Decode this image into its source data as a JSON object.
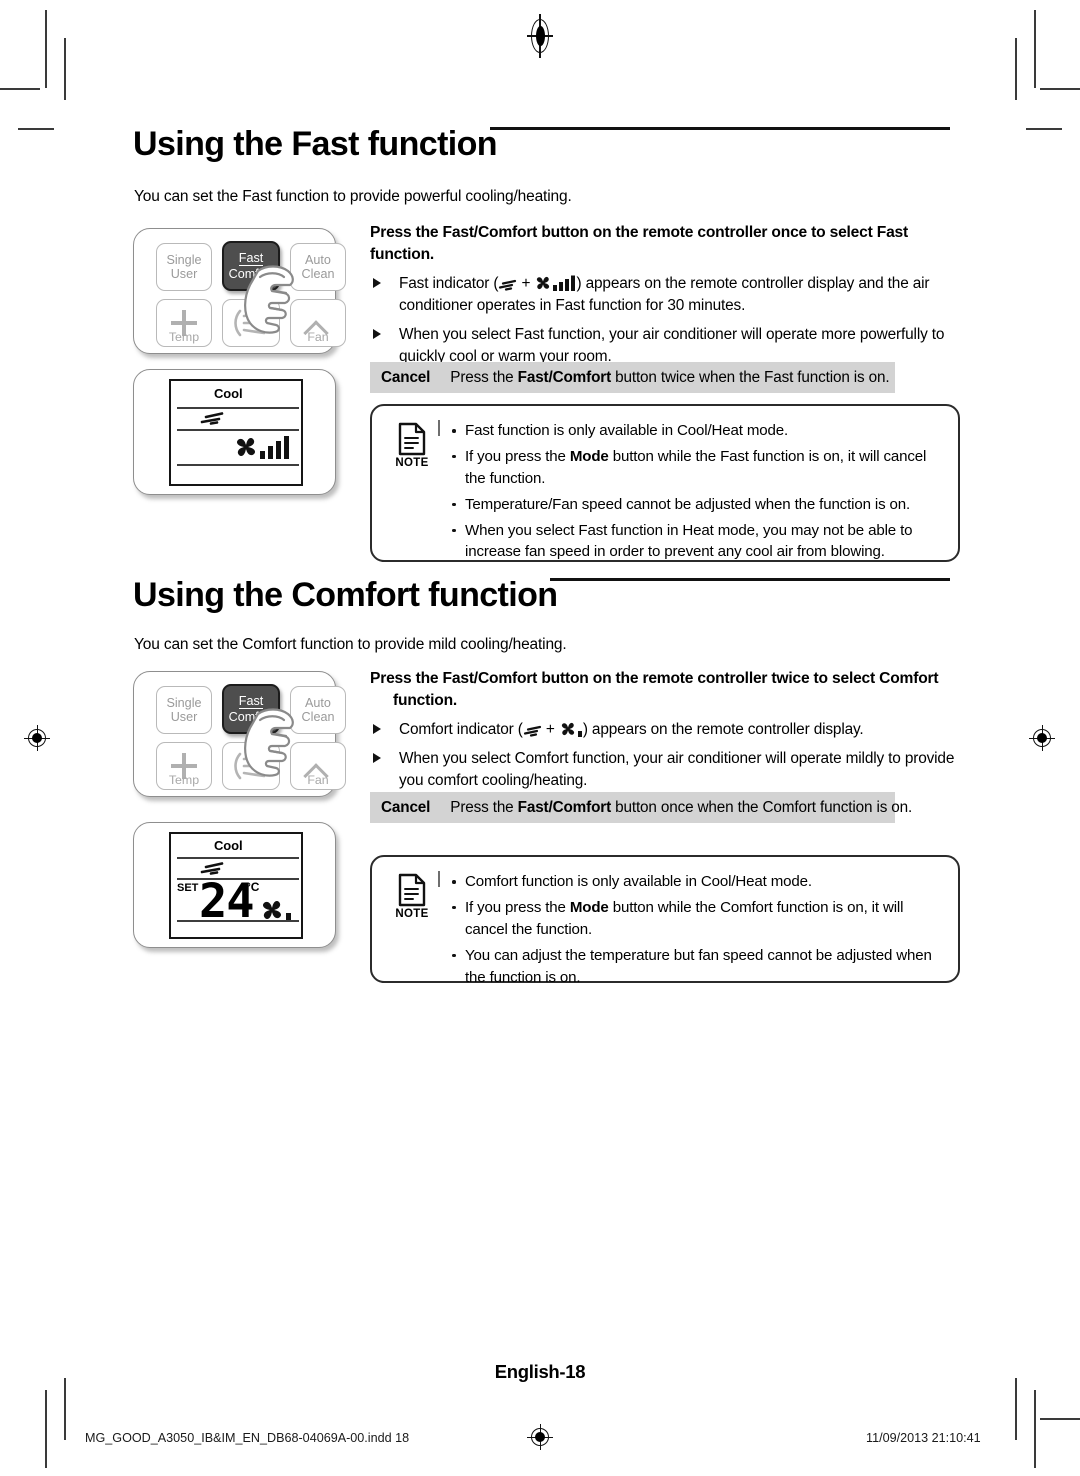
{
  "document": {
    "page_number_label": "English-18",
    "footer_file": "MG_GOOD_A3050_IB&IM_EN_DB68-04069A-00.indd   18",
    "footer_date": "11/09/2013   21:10:41"
  },
  "sections": [
    {
      "id": "fast",
      "title": "Using the Fast function",
      "intro": "You can set the Fast function to provide powerful cooling/heating.",
      "lead": {
        "before": "Press the ",
        "bold": "Fast/Comfort",
        "after": " button on the remote controller once to select Fast function.",
        "second_line": ""
      },
      "bullets": [
        {
          "pre": "Fast indicator (",
          "icons": "swirl + fan-4bars",
          "post": ") appears on the remote controller display and the air conditioner operates in Fast function for 30 minutes."
        },
        {
          "pre": "",
          "icons": "",
          "post": "When you select Fast function, your air conditioner will operate more powerfully to quickly cool or warm your room."
        }
      ],
      "cancel": {
        "label": "Cancel",
        "before": "Press the ",
        "bold": "Fast/Comfort",
        "after": " button twice when the Fast function is on."
      },
      "note": {
        "label": "NOTE",
        "items": [
          {
            "text": "Fast function is only available in Cool/Heat mode.",
            "bold": ""
          },
          {
            "pre": "If you press the ",
            "bold": "Mode",
            "post": " button while the Fast function is on, it will cancel the function."
          },
          {
            "text": "Temperature/Fan speed cannot be adjusted when the function is on.",
            "bold": ""
          },
          {
            "text": "When you select Fast function in Heat mode, you may not be able to increase fan speed in order to prevent any cool air from blowing.",
            "bold": ""
          }
        ]
      },
      "remote": {
        "buttons": [
          {
            "line1": "Single",
            "line2": "User",
            "state": "normal"
          },
          {
            "line1": "Fast",
            "line2": "Comfort",
            "state": "pressed"
          },
          {
            "line1": "Auto",
            "line2": "Clean",
            "state": "normal"
          },
          {
            "line1": "",
            "line2": "Temp",
            "state": "icon-plus"
          },
          {
            "line1": "",
            "line2": "",
            "state": "icon-swing"
          },
          {
            "line1": "",
            "line2": "Fan",
            "state": "icon-chevron"
          }
        ]
      },
      "lcd": {
        "mode": "Cool",
        "set_label": "",
        "temperature": "",
        "unit": "",
        "show_temp": false,
        "fan_bars": 4
      }
    },
    {
      "id": "comfort",
      "title": "Using the Comfort function",
      "intro": "You can set the Comfort function to provide mild cooling/heating.",
      "lead": {
        "before": "Press the ",
        "bold": "Fast/Comfort",
        "after": " button on the remote controller twice to select Comfort",
        "second_line": "function."
      },
      "bullets": [
        {
          "pre": "Comfort indicator (",
          "icons": "swirl + fan-1bar",
          "post": ") appears on the remote controller display."
        },
        {
          "pre": "",
          "icons": "",
          "post": "When you select Comfort function, your air conditioner will operate mildly to provide you comfort cooling/heating."
        }
      ],
      "cancel": {
        "label": "Cancel",
        "before": "Press the ",
        "bold": "Fast/Comfort",
        "after": " button once when the Comfort function is on."
      },
      "note": {
        "label": "NOTE",
        "items": [
          {
            "text": "Comfort function is only available in Cool/Heat mode.",
            "bold": ""
          },
          {
            "pre": "If you press the ",
            "bold": "Mode",
            "post": " button while the Comfort function is on, it will cancel the function."
          },
          {
            "text": "You can adjust the temperature but fan speed cannot be adjusted when the function is on.",
            "bold": ""
          }
        ]
      },
      "remote": {
        "buttons": [
          {
            "line1": "Single",
            "line2": "User",
            "state": "normal"
          },
          {
            "line1": "Fast",
            "line2": "Comfort",
            "state": "pressed"
          },
          {
            "line1": "Auto",
            "line2": "Clean",
            "state": "normal"
          },
          {
            "line1": "",
            "line2": "Temp",
            "state": "icon-plus"
          },
          {
            "line1": "",
            "line2": "",
            "state": "icon-swing"
          },
          {
            "line1": "",
            "line2": "Fan",
            "state": "icon-chevron"
          }
        ]
      },
      "lcd": {
        "mode": "Cool",
        "set_label": "SET",
        "temperature": "24",
        "unit": "°C",
        "show_temp": true,
        "fan_bars": 1
      }
    }
  ],
  "colors": {
    "cancel_bar_bg": "#d3d3d3",
    "rule": "#111111",
    "button_pressed_bg": "#4e4e4e",
    "button_outline": "#b9b9b9"
  }
}
